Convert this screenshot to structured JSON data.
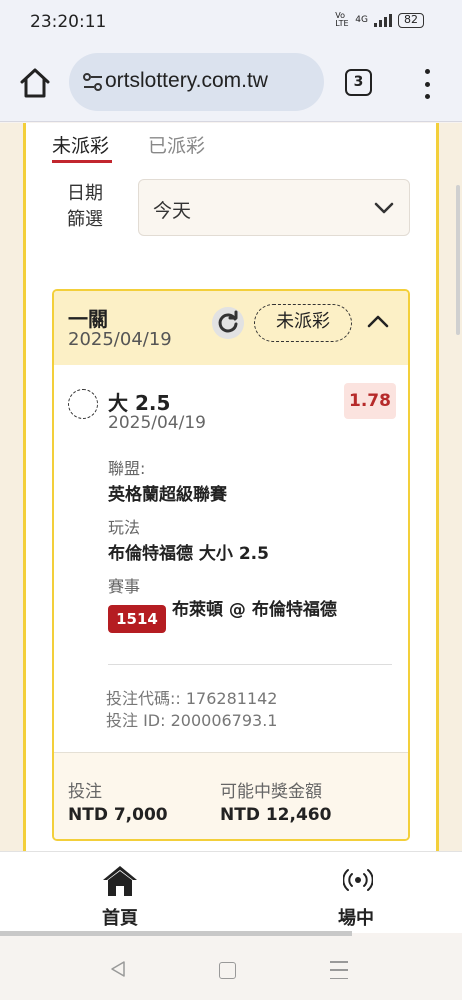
{
  "status_bar": {
    "time": "23:20:11",
    "network": "4G",
    "volte": "Vo LTE",
    "battery": "82"
  },
  "browser": {
    "url": "ortslottery.com.tw",
    "tab_count": "3"
  },
  "tabs": {
    "unpaid": "未派彩",
    "paid": "已派彩",
    "active": "unpaid"
  },
  "filter": {
    "label": "日期篩選",
    "selected": "今天"
  },
  "bet": {
    "type": "一關",
    "date": "2025/04/19",
    "status": "未派彩",
    "selection": "大 2.5",
    "selection_date": "2025/04/19",
    "odds": "1.78",
    "league_label": "聯盟:",
    "league": "英格蘭超級聯賽",
    "market_label": "玩法",
    "market": "布倫特福德 大小 2.5",
    "event_label": "賽事",
    "event_number": "1514",
    "event": "布萊頓 @ 布倫特福德",
    "bet_code": "投注代碼:: 176281142",
    "bet_id": "投注 ID: 200006793.1",
    "stake_label": "投注",
    "stake": "NTD 7,000",
    "payout_label": "可能中獎金額",
    "payout": "NTD 12,460"
  },
  "bottom_nav": {
    "home": "首頁",
    "live": "場中"
  },
  "colors": {
    "accent_red": "#c2262e",
    "frame_yellow": "#f3cf3a",
    "header_bg": "#fcf0c6",
    "badge_red": "#b51d22"
  }
}
